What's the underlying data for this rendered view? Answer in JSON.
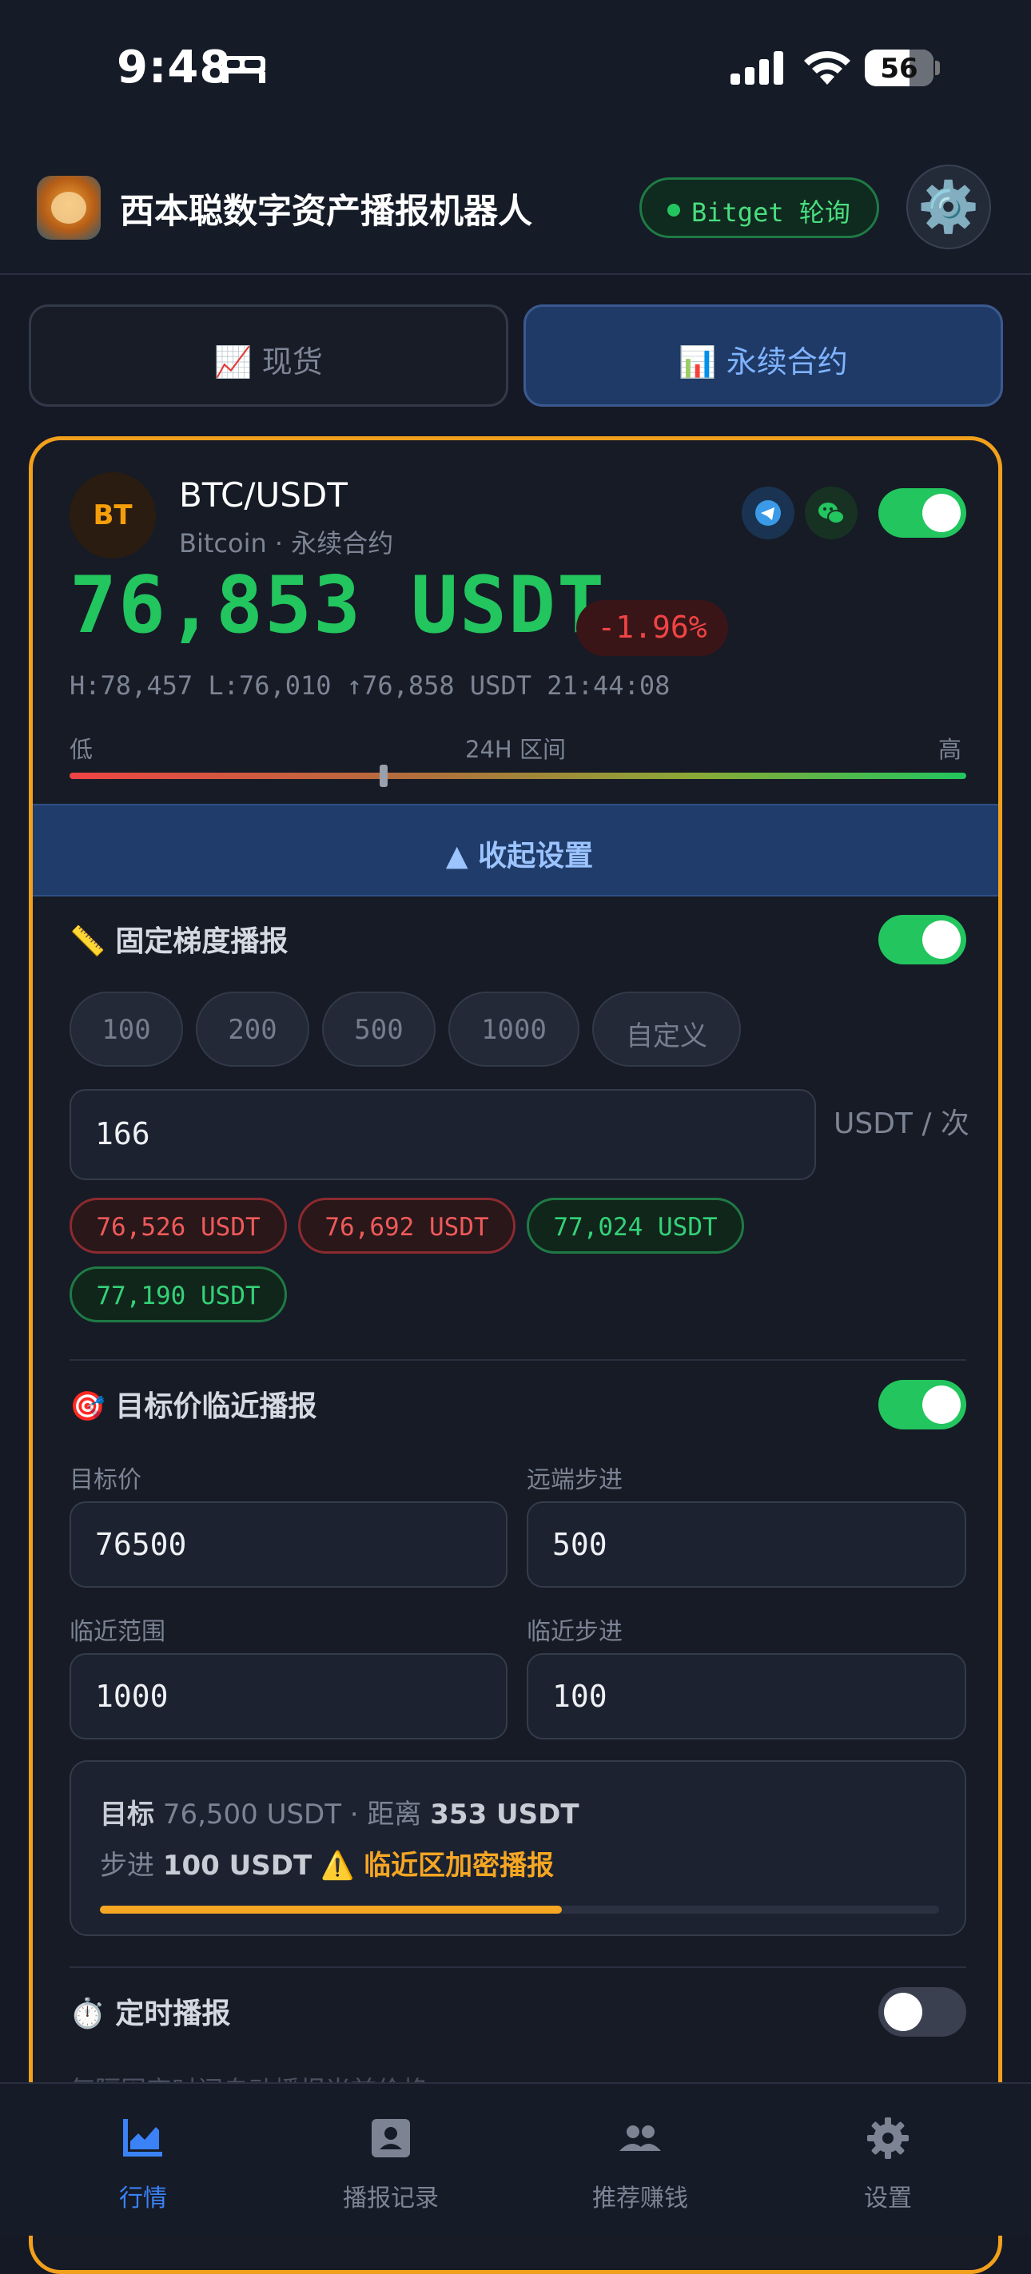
{
  "status_bar": {
    "time": "9:48",
    "battery": "56"
  },
  "header": {
    "title": "西本聪数字资产播报机器人",
    "exchange_badge": "Bitget 轮询",
    "settings_icon": "⚙️"
  },
  "tabs": [
    {
      "label": "📈 现货",
      "active": false
    },
    {
      "label": "📊 永续合约",
      "active": true
    }
  ],
  "ticker": {
    "coin_abbr": "BT",
    "pair": "BTC/USDT",
    "subtitle": "Bitcoin · 永续合约",
    "telegram_enabled": true,
    "wechat_enabled": true,
    "enabled": true,
    "price": "76,853 USDT",
    "change": "-1.96%",
    "stats": "H:78,457 L:76,010 ↑76,858 USDT 21:44:08",
    "range": {
      "low_label": "低",
      "mid_label": "24H 区间",
      "high_label": "高",
      "position_pct": 35
    }
  },
  "collapse_label": "▲ 收起设置",
  "fixed_step": {
    "title": "📏 固定梯度播报",
    "enabled": true,
    "presets": [
      "100",
      "200",
      "500",
      "1000",
      "自定义"
    ],
    "value": "166",
    "unit": "USDT / 次",
    "levels": [
      {
        "text": "76,526 USDT",
        "tone": "down"
      },
      {
        "text": "76,692 USDT",
        "tone": "down"
      },
      {
        "text": "77,024 USDT",
        "tone": "up"
      },
      {
        "text": "77,190 USDT",
        "tone": "up"
      }
    ]
  },
  "target": {
    "title": "🎯 目标价临近播报",
    "enabled": true,
    "fields": {
      "target_price": {
        "label": "目标价",
        "value": "76500"
      },
      "far_step": {
        "label": "远端步进",
        "value": "500"
      },
      "near_range": {
        "label": "临近范围",
        "value": "1000"
      },
      "near_step": {
        "label": "临近步进",
        "value": "100"
      }
    },
    "summary": {
      "target_label": "目标",
      "target_value": "76,500 USDT · 距离",
      "distance": "353 USDT",
      "step_label": "步进",
      "step_value": "100 USDT",
      "warning": "⚠️ 临近区加密播报",
      "progress_pct": 0.55
    }
  },
  "timed": {
    "title": "⏱️ 定时播报",
    "enabled": false,
    "desc": "每隔固定时间自动播报当前价格"
  },
  "bottom_nav": [
    {
      "label": "行情",
      "icon": "chart-icon",
      "active": true
    },
    {
      "label": "播报记录",
      "icon": "user-record-icon",
      "active": false
    },
    {
      "label": "推荐赚钱",
      "icon": "people-icon",
      "active": false
    },
    {
      "label": "设置",
      "icon": "gear-icon",
      "active": false
    }
  ],
  "colors": {
    "accent_orange": "#f2a01c",
    "up_green": "#22c55e",
    "down_red": "#ef4444",
    "active_blue": "#3b82f6"
  }
}
